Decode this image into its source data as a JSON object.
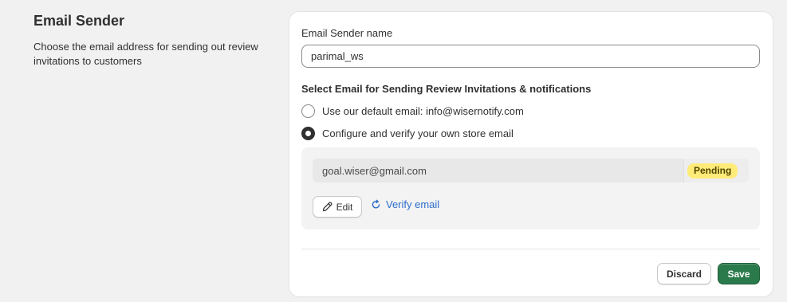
{
  "section": {
    "title": "Email Sender",
    "description": "Choose the email address for sending out review invitations to customers"
  },
  "form": {
    "sender_name_label": "Email Sender name",
    "sender_name_value": "parimal_ws",
    "choice_title": "Select Email for Sending Review Invitations & notifications",
    "options": [
      {
        "label": "Use our default email: info@wisernotify.com",
        "selected": false
      },
      {
        "label": "Configure and verify your own store email",
        "selected": true
      }
    ],
    "custom_email": {
      "value": "goal.wiser@gmail.com",
      "status": "Pending",
      "status_color": "#ffeb78",
      "edit_label": "Edit",
      "edit_icon": "pencil-icon",
      "verify_label": "Verify email",
      "verify_icon": "refresh-icon"
    }
  },
  "actions": {
    "discard_label": "Discard",
    "save_label": "Save",
    "save_color": "#2b7a4b"
  }
}
